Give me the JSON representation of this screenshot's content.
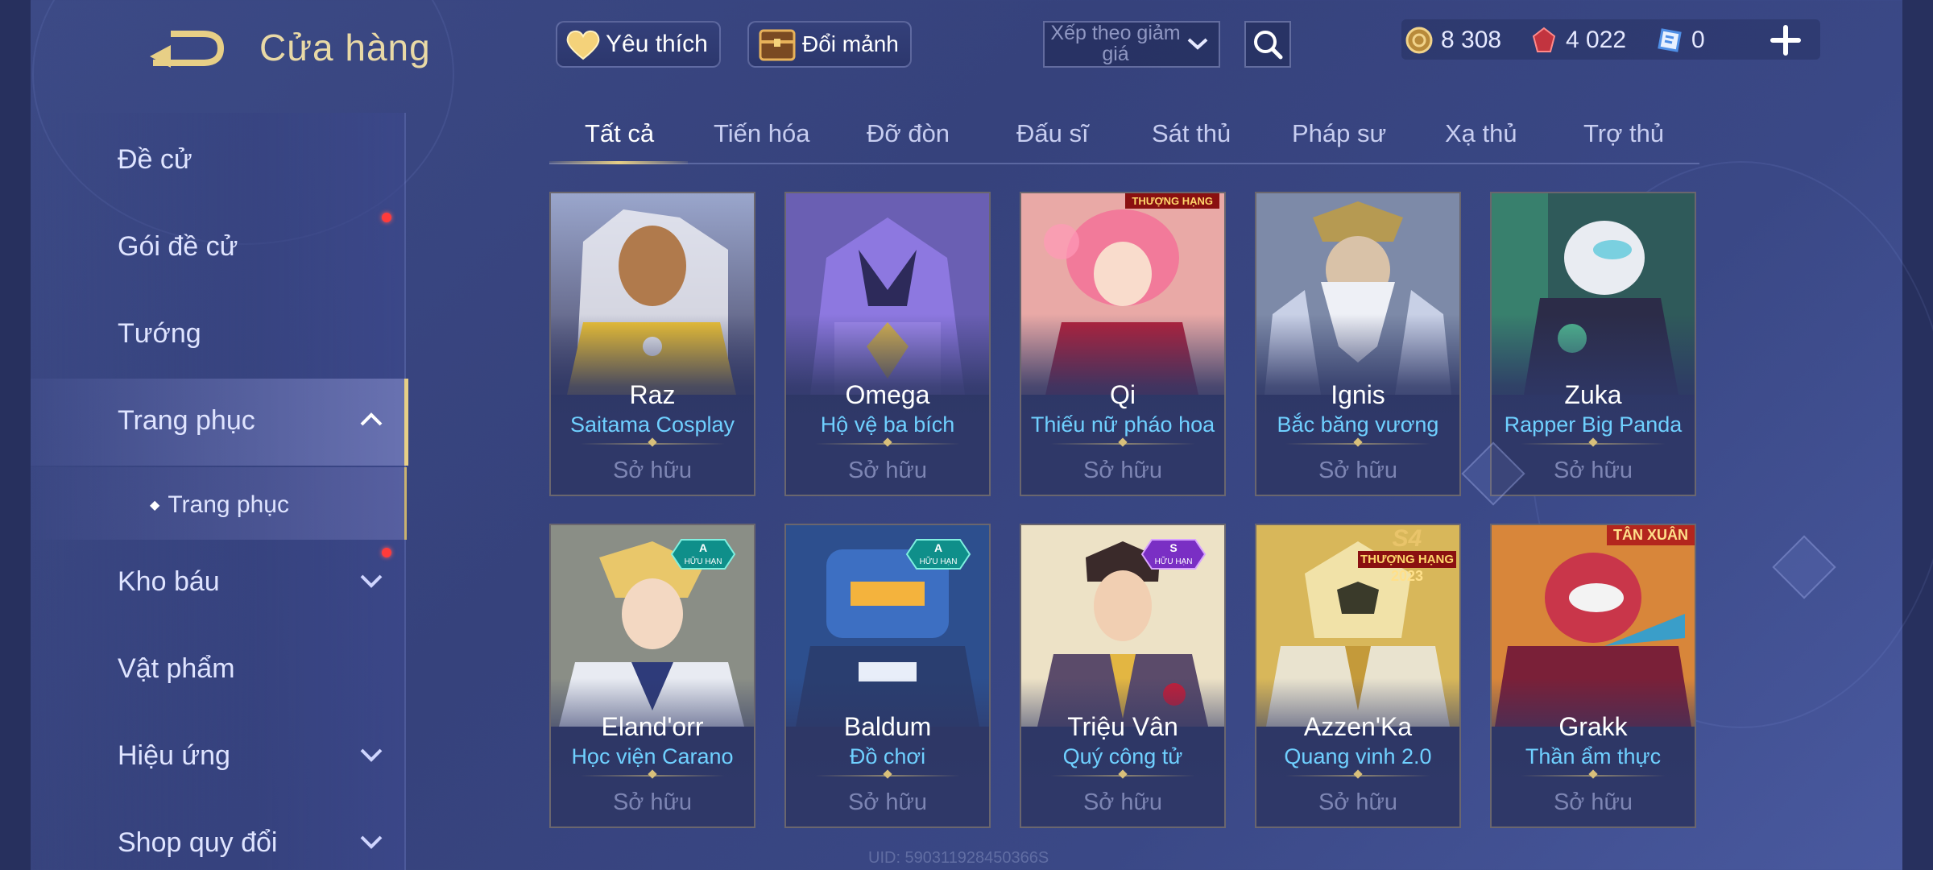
{
  "header": {
    "title": "Cửa hàng",
    "favorites_label": "Yêu thích",
    "exchange_label": "Đổi mảnh",
    "sort_label": "Xếp theo giảm giá",
    "currencies": [
      {
        "icon": "gold-coin-icon",
        "value": "8 308"
      },
      {
        "icon": "red-gem-icon",
        "value": "4 022"
      },
      {
        "icon": "blue-voucher-icon",
        "value": "0"
      }
    ]
  },
  "sidebar": {
    "items": [
      {
        "label": "Đề cử"
      },
      {
        "label": "Gói đề cử"
      },
      {
        "label": "Tướng"
      },
      {
        "label": "Trang phục"
      },
      {
        "label": "Kho báu"
      },
      {
        "label": "Vật phẩm"
      },
      {
        "label": "Hiệu ứng"
      },
      {
        "label": "Shop quy đổi"
      }
    ],
    "subitem": "Trang phục"
  },
  "tabs": [
    "Tất cả",
    "Tiến hóa",
    "Đỡ đòn",
    "Đấu sĩ",
    "Sát thủ",
    "Pháp sư",
    "Xạ thủ",
    "Trợ thủ"
  ],
  "cards": [
    {
      "hero": "Raz",
      "skin": "Saitama Cosplay",
      "status": "Sở hữu"
    },
    {
      "hero": "Omega",
      "skin": "Hộ vệ ba bích",
      "status": "Sở hữu"
    },
    {
      "hero": "Qi",
      "skin": "Thiếu nữ pháo hoa",
      "status": "Sở hữu",
      "ribbon": "THƯỢNG HẠNG"
    },
    {
      "hero": "Ignis",
      "skin": "Bắc băng vương",
      "status": "Sở hữu"
    },
    {
      "hero": "Zuka",
      "skin": "Rapper Big Panda",
      "status": "Sở hữu"
    },
    {
      "hero": "Eland'orr",
      "skin": "Học viện Carano",
      "status": "Sở hữu",
      "badge_grade": "A",
      "badge_text": "HỮU HẠN"
    },
    {
      "hero": "Baldum",
      "skin": "Đồ chơi",
      "status": "Sở hữu",
      "badge_grade": "A",
      "badge_text": "HỮU HẠN"
    },
    {
      "hero": "Triệu Vân",
      "skin": "Quý công tử",
      "status": "Sở hữu",
      "badge_grade": "S",
      "badge_text": "HỮU HẠN"
    },
    {
      "hero": "Azzen'Ka",
      "skin": "Quang vinh 2.0",
      "status": "Sở hữu",
      "ribbon_top": "S4",
      "ribbon": "THƯỢNG HẠNG",
      "ribbon_year": "2023"
    },
    {
      "hero": "Grakk",
      "skin": "Thần ẩm thực",
      "status": "Sở hữu",
      "ribbon": "TÂN XUÂN"
    }
  ],
  "footer": {
    "uid": "UID: 590311928450366S"
  },
  "colors": {
    "accent_gold": "#e7cf86",
    "skin_blue": "#6fd0ff",
    "notify_red": "#ff3b3b"
  }
}
